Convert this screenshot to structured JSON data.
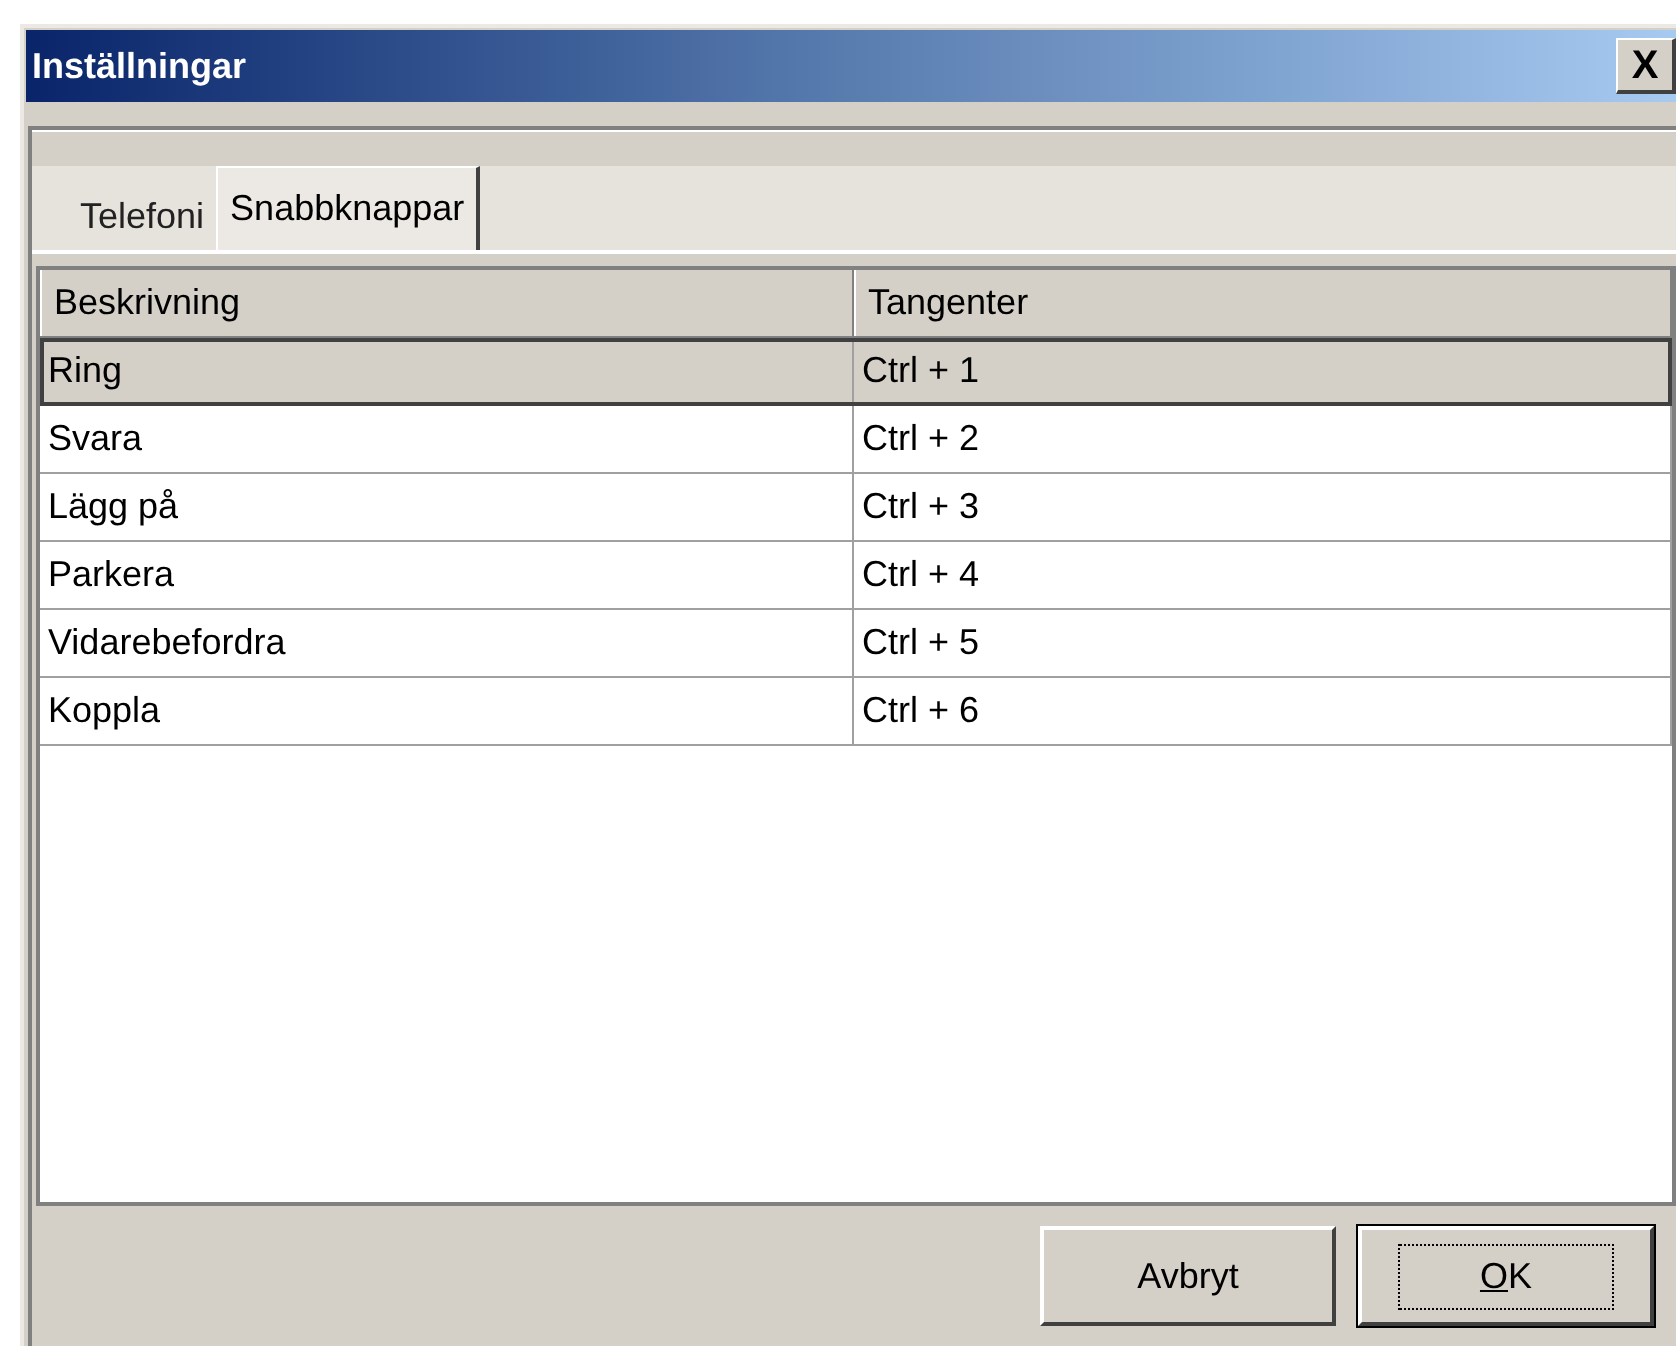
{
  "window": {
    "title": "Inställningar",
    "close": "X"
  },
  "tabs": [
    {
      "label": "Telefoni",
      "selected": false
    },
    {
      "label": "Snabbknappar",
      "selected": true
    }
  ],
  "table": {
    "columns": [
      "Beskrivning",
      "Tangenter"
    ],
    "rows": [
      {
        "cells": [
          "Ring",
          "Ctrl + 1"
        ],
        "selected": true
      },
      {
        "cells": [
          "Svara",
          "Ctrl + 2"
        ],
        "selected": false
      },
      {
        "cells": [
          "Lägg på",
          "Ctrl + 3"
        ],
        "selected": false
      },
      {
        "cells": [
          "Parkera",
          "Ctrl + 4"
        ],
        "selected": false
      },
      {
        "cells": [
          "Vidarebefordra",
          "Ctrl + 5"
        ],
        "selected": false
      },
      {
        "cells": [
          "Koppla",
          "Ctrl + 6"
        ],
        "selected": false
      }
    ]
  },
  "buttons": [
    {
      "label": "Avbryt",
      "default": false
    },
    {
      "label": "OK",
      "default": true
    }
  ]
}
